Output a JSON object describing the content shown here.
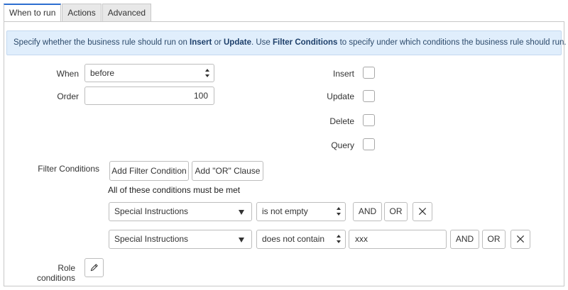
{
  "tabs": [
    {
      "label": "When to run",
      "active": true
    },
    {
      "label": "Actions",
      "active": false
    },
    {
      "label": "Advanced",
      "active": false
    }
  ],
  "info": {
    "t1": "Specify whether the business rule should run on ",
    "b1": "Insert",
    "t2": " or ",
    "b2": "Update",
    "t3": ". Use ",
    "b3": "Filter Conditions",
    "t4": " to specify under which conditions the business rule should run."
  },
  "form": {
    "when_label": "When",
    "when_value": "before",
    "order_label": "Order",
    "order_value": "100",
    "insert_label": "Insert",
    "update_label": "Update",
    "delete_label": "Delete",
    "query_label": "Query",
    "insert_checked": false,
    "update_checked": false,
    "delete_checked": false,
    "query_checked": false
  },
  "filter": {
    "label": "Filter Conditions",
    "add_condition": "Add Filter Condition",
    "add_or": "Add \"OR\" Clause",
    "all_met": "All of these conditions must be met",
    "rows": [
      {
        "field": "Special Instructions",
        "operator": "is not empty",
        "value": "",
        "and": "AND",
        "or": "OR"
      },
      {
        "field": "Special Instructions",
        "operator": "does not contain",
        "value": "xxx",
        "and": "AND",
        "or": "OR"
      }
    ]
  },
  "role": {
    "label": "Role conditions"
  },
  "icons": {
    "remove": "close-icon",
    "edit": "pencil-icon",
    "dropdown": "caret-down-icon",
    "select": "updown-arrows-icon"
  },
  "colors": {
    "tab_accent": "#2d6ed0",
    "info_bg": "#e0eefc",
    "info_text": "#2c4a6b"
  }
}
